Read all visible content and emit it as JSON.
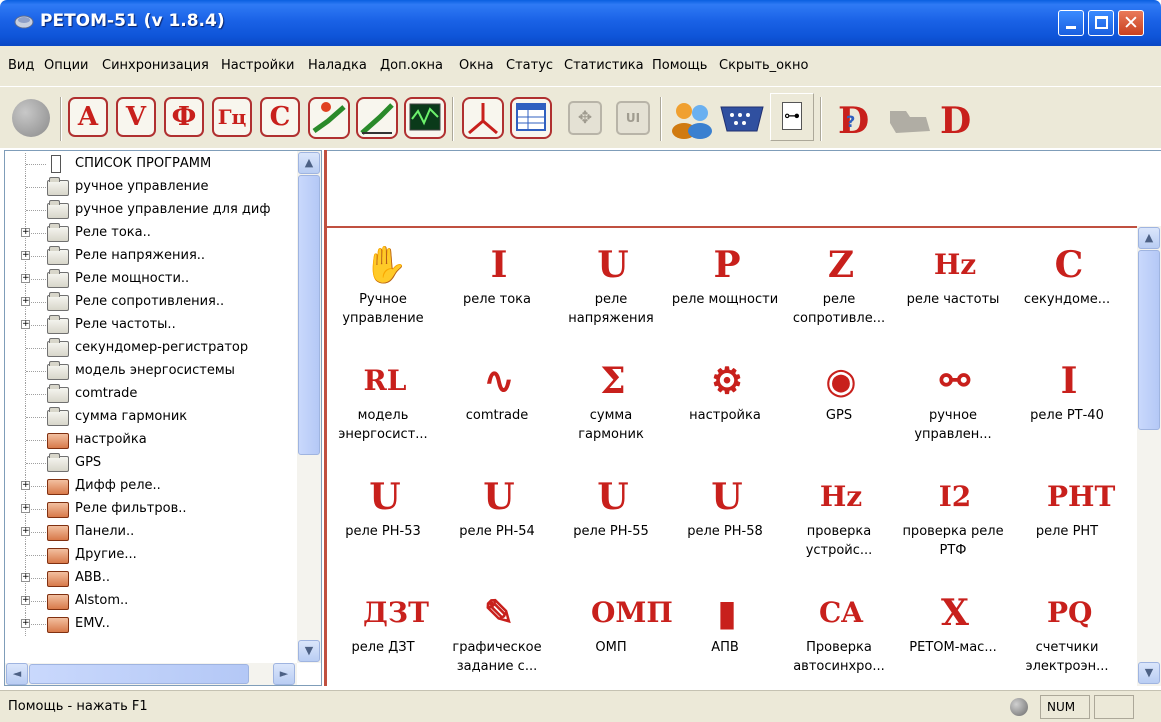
{
  "window": {
    "title": "РЕТОМ-51 (v 1.8.4)",
    "close_glyph": "✕"
  },
  "menu": [
    "Вид",
    "Опции",
    "Синхронизация",
    "Настройки",
    "Наладка",
    "Доп.окна",
    "Окна",
    "Статус",
    "Статистика",
    "Помощь",
    "Скрыть_окно"
  ],
  "toolbar": {
    "letters": [
      "A",
      "V",
      "Ф",
      "Гц",
      "C"
    ],
    "last_letter": "D",
    "tree_glyph": "⊶"
  },
  "tree": {
    "plus_glyph": "+",
    "items": [
      {
        "label": "СПИСОК ПРОГРАММ",
        "icon": "program-list-icon",
        "expand": false
      },
      {
        "label": "ручное управление",
        "icon": "folder-icon",
        "expand": false
      },
      {
        "label": "ручное управление для диф",
        "icon": "folder-icon",
        "expand": false
      },
      {
        "label": "Реле тока..",
        "icon": "folder-icon",
        "expand": true
      },
      {
        "label": "Реле напряжения..",
        "icon": "folder-icon",
        "expand": true
      },
      {
        "label": "Реле мощности..",
        "icon": "folder-icon",
        "expand": true
      },
      {
        "label": "Реле сопротивления..",
        "icon": "folder-icon",
        "expand": true
      },
      {
        "label": "Реле частоты..",
        "icon": "folder-icon",
        "expand": true
      },
      {
        "label": "секундомер-регистратор",
        "icon": "folder-icon",
        "expand": false
      },
      {
        "label": "модель энергосистемы",
        "icon": "folder-icon",
        "expand": false
      },
      {
        "label": "comtrade",
        "icon": "folder-icon",
        "expand": false
      },
      {
        "label": "сумма гармоник",
        "icon": "folder-icon",
        "expand": false
      },
      {
        "label": "настройка",
        "icon": "red-folder-icon",
        "expand": false
      },
      {
        "label": "GPS",
        "icon": "folder-icon",
        "expand": false
      },
      {
        "label": "Дифф реле..",
        "icon": "red-folder-icon",
        "expand": true
      },
      {
        "label": "Реле фильтров..",
        "icon": "red-folder-icon",
        "expand": true
      },
      {
        "label": "Панели..",
        "icon": "red-folder-icon",
        "expand": true
      },
      {
        "label": "Другие...",
        "icon": "red-folder-icon",
        "expand": false
      },
      {
        "label": "ABB..",
        "icon": "red-folder-icon",
        "expand": true
      },
      {
        "label": "Alstom..",
        "icon": "red-folder-icon",
        "expand": true
      },
      {
        "label": "EMV..",
        "icon": "red-folder-icon",
        "expand": true
      }
    ]
  },
  "grid": {
    "items": [
      {
        "glyph": "✋",
        "label": "Ручное управление",
        "icon": "hand-icon"
      },
      {
        "glyph": "I",
        "label": "реле тока",
        "icon": "current-relay-icon"
      },
      {
        "glyph": "U",
        "label": "реле напряжения",
        "icon": "voltage-relay-icon"
      },
      {
        "glyph": "P",
        "label": "реле мощности",
        "icon": "power-relay-icon"
      },
      {
        "glyph": "Z",
        "label": "реле сопротивле...",
        "icon": "impedance-relay-icon"
      },
      {
        "glyph": "Hz",
        "label": "реле частоты",
        "icon": "frequency-relay-icon"
      },
      {
        "glyph": "C",
        "label": "секундоме...",
        "icon": "stopwatch-icon"
      },
      {
        "glyph": "RL",
        "label": "модель энергосист...",
        "icon": "power-system-model-icon"
      },
      {
        "glyph": "∿",
        "label": "comtrade",
        "icon": "comtrade-icon"
      },
      {
        "glyph": "Σ",
        "label": "сумма гармоник",
        "icon": "sum-icon"
      },
      {
        "glyph": "⚙",
        "label": "настройка",
        "icon": "settings-icon"
      },
      {
        "glyph": "◉",
        "label": "GPS",
        "icon": "gps-dish-icon"
      },
      {
        "glyph": "⚯",
        "label": "ручное управлен...",
        "icon": "gears-icon"
      },
      {
        "glyph": "I",
        "label": "реле РТ-40",
        "icon": "rt40-relay-icon"
      },
      {
        "glyph": "U",
        "label": "реле РН-53",
        "icon": "rn53-relay-icon"
      },
      {
        "glyph": "U",
        "label": "реле РН-54",
        "icon": "rn54-relay-icon"
      },
      {
        "glyph": "U",
        "label": "реле РН-55",
        "icon": "rn55-relay-icon"
      },
      {
        "glyph": "U",
        "label": "реле РН-58",
        "icon": "rn58-relay-icon"
      },
      {
        "glyph": "Hz",
        "label": "проверка устройс...",
        "icon": "frequency-check-icon"
      },
      {
        "glyph": "I2",
        "label": "проверка реле РТФ",
        "icon": "rtf-relay-icon"
      },
      {
        "glyph": "РНТ",
        "label": "реле РНТ",
        "icon": "rnt-relay-icon"
      },
      {
        "glyph": "ДЗТ",
        "label": "реле ДЗТ",
        "icon": "dzt-relay-icon"
      },
      {
        "glyph": "✎",
        "label": "графическое задание с...",
        "icon": "pencil-cup-icon"
      },
      {
        "glyph": "ОМП",
        "label": "ОМП",
        "icon": "omp-icon"
      },
      {
        "glyph": "▮",
        "label": "АПВ",
        "icon": "server-icon"
      },
      {
        "glyph": "CA",
        "label": "Проверка автосинхро...",
        "icon": "autosync-icon"
      },
      {
        "glyph": "X",
        "label": "РЕТОМ-мас...",
        "icon": "excel-icon"
      },
      {
        "glyph": "PQ",
        "label": "счетчики электроэн...",
        "icon": "energy-meter-icon"
      }
    ]
  },
  "statusbar": {
    "help": "Помощь - нажать F1",
    "num": "NUM"
  },
  "scroll": {
    "up": "▲",
    "down": "▼",
    "left": "◄",
    "right": "►"
  }
}
